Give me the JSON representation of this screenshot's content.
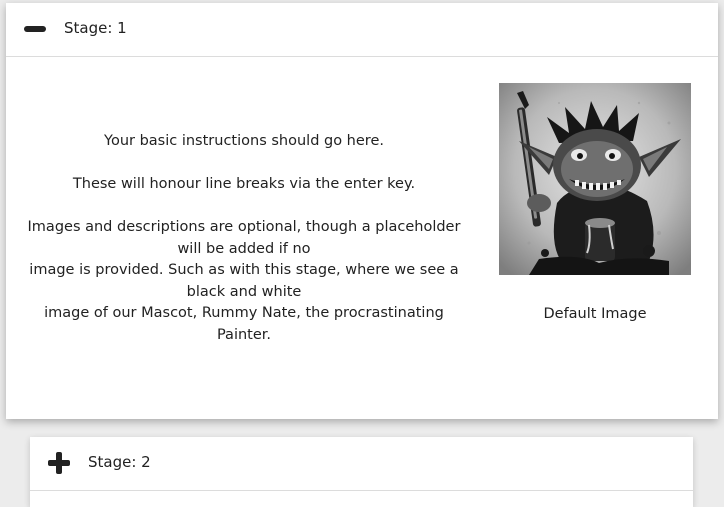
{
  "stages": [
    {
      "title": "Stage: 1",
      "toggle_icon": "minus-icon",
      "expanded": true,
      "instructions": [
        "Your basic instructions should go here.",
        "",
        "These will honour line breaks via the enter key.",
        "",
        "Images and descriptions are optional, though a placeholder will be added if no",
        "image is provided. Such as with this stage, where we see a black and white",
        "image of our Mascot, Rummy Nate, the procrastinating Painter."
      ],
      "image_caption": "Default Image"
    },
    {
      "title": "Stage: 2",
      "toggle_icon": "plus-icon",
      "expanded": false
    }
  ],
  "colors": {
    "background": "#ececec",
    "card": "#ffffff",
    "text": "#222222",
    "divider": "#dcdcdc"
  }
}
